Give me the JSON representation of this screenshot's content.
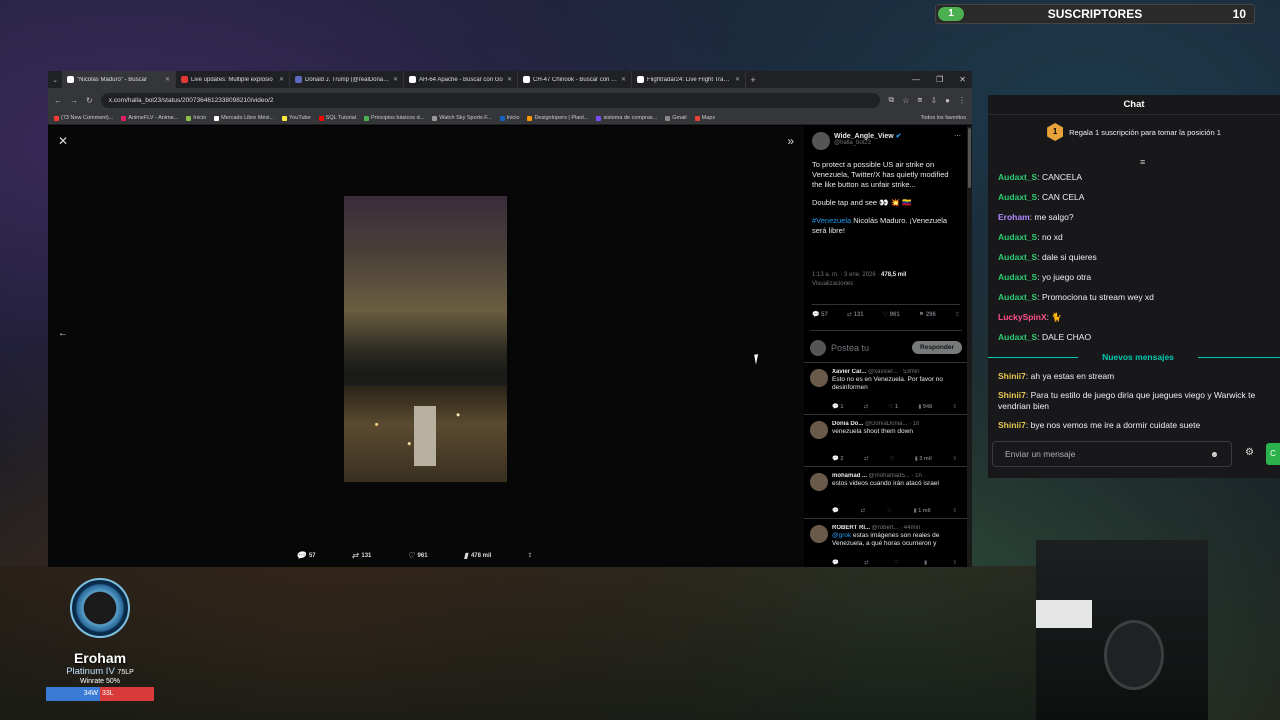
{
  "browser": {
    "tabs": [
      {
        "label": "\"Nicolás Maduro\" - Buscar",
        "color": "#ffffff",
        "active": true
      },
      {
        "label": "Live updates: Multiple explosio",
        "color": "#e53935",
        "active": false
      },
      {
        "label": "Donald J. Trump (@realDonaldT",
        "color": "#5c6bc0",
        "active": false
      },
      {
        "label": "AH-64 Apache - Buscar con Go",
        "color": "#ffffff",
        "active": false
      },
      {
        "label": "CH-47 Chinook - Buscar con Go",
        "color": "#ffffff",
        "active": false
      },
      {
        "label": "Flightradar24: Live Flight Tracke",
        "color": "#ffffff",
        "active": false
      }
    ],
    "url": "x.com/halla_bol23/status/2007364612338098210/video/2",
    "bookmarks": [
      "(73 New Comment)...",
      "AnimeFLV - Anime...",
      "Inicio",
      "Mercado Libre Méxi...",
      "YouTube",
      "SQL Tutorial",
      "Principios básicos d...",
      "Watch Sky Sports F...",
      "Inicio",
      "DesignIopers | Plant...",
      "sistema de compras...",
      "Gmail",
      "Maps"
    ],
    "all_bookmarks": "Todos los favoritos"
  },
  "media": {
    "stats": {
      "replies": "57",
      "reposts": "131",
      "likes": "961",
      "views": "478 mil"
    }
  },
  "post": {
    "author_name": "Wide_Angle_View",
    "author_handle": "@halla_bol23",
    "text1": "To protect a possible US air strike on Venezuela, Twitter/X has quietly modified the like button as unfair strike...",
    "text2": "Double tap and see 👀 💥 🇻🇪",
    "hashtag": "#Venezuela",
    "text3": " Nicolás Maduro. ¡Venezuela será libre!",
    "time": "1:13 a. m. · 3 ene. 2026 · ",
    "views": "478,5 mil",
    "views_label": "Visualizaciones",
    "actions": {
      "replies": "57",
      "reposts": "131",
      "likes": "961",
      "bookmarks": "296"
    },
    "reply_placeholder": "Postea tu",
    "reply_button": "Responder"
  },
  "comments": [
    {
      "name": "Xavier Car...",
      "meta": " @xaviser... · 53min",
      "text": "Esto no es en Venezuela. Por favor no desinformen",
      "mention": "",
      "r": "1",
      "rt": "",
      "l": "1",
      "v": "948"
    },
    {
      "name": "Donia Do...",
      "meta": " @DoniaDonia... · 1h",
      "text": "venezuela shoot them down",
      "mention": "",
      "r": "2",
      "rt": "",
      "l": "",
      "v": "3 mil"
    },
    {
      "name": "mohamad ...",
      "meta": " @mohamad5... · 1h",
      "text": "estos videos cuando irán atacó israel",
      "mention": "",
      "r": "",
      "rt": "",
      "l": "",
      "v": "1 mil"
    },
    {
      "name": "ROBERT RI...",
      "meta": " @robert... · 44min",
      "text": " estas imágenes son reales de Venezuela, a qué horas ocurrieron y",
      "mention": "@grok",
      "r": "",
      "rt": "",
      "l": "",
      "v": ""
    }
  ],
  "subs": {
    "current": "1",
    "label": "SUSCRIPTORES",
    "goal": "10"
  },
  "chat": {
    "title": "Chat",
    "promo": "Regala 1 suscripción para tomar la posición 1",
    "messages": [
      {
        "user": "Audaxt_S",
        "color": "#2ecc71",
        "text": ": CANCELA"
      },
      {
        "user": "Audaxt_S",
        "color": "#2ecc71",
        "text": ": CAN CELA"
      },
      {
        "user": "Eroham",
        "color": "#b388ff",
        "text": ": me salgo?"
      },
      {
        "user": "Audaxt_S",
        "color": "#2ecc71",
        "text": ": no xd"
      },
      {
        "user": "Audaxt_S",
        "color": "#2ecc71",
        "text": ": dale si quieres"
      },
      {
        "user": "Audaxt_S",
        "color": "#2ecc71",
        "text": ": yo juego otra"
      },
      {
        "user": "Audaxt_S",
        "color": "#2ecc71",
        "text": ": Promociona tu stream wey xd"
      },
      {
        "user": "LuckySpinX",
        "color": "#ff4f8b",
        "text": ": 🐈"
      },
      {
        "user": "Audaxt_S",
        "color": "#2ecc71",
        "text": ": DALE CHAO"
      }
    ],
    "new_messages_label": "Nuevos mensajes",
    "new_messages": [
      {
        "user": "Shinii7",
        "color": "#e6c84f",
        "text": ": ah ya estas en stream"
      },
      {
        "user": "Shinii7",
        "color": "#e6c84f",
        "text": ": Para tu estilo de juego diria que juegues viego y Warwick te vendrian bien"
      },
      {
        "user": "Shinii7",
        "color": "#e6c84f",
        "text": ": bye nos vemos me ire a dormir cuidate suete"
      }
    ],
    "input_placeholder": "Enviar un mensaje",
    "send_label": "C"
  },
  "rank": {
    "name": "Eroham",
    "tier": "Platinum IV ",
    "lp": "75LP",
    "winrate": "Winrate 50%",
    "wins": "34W",
    "losses": "33L"
  }
}
